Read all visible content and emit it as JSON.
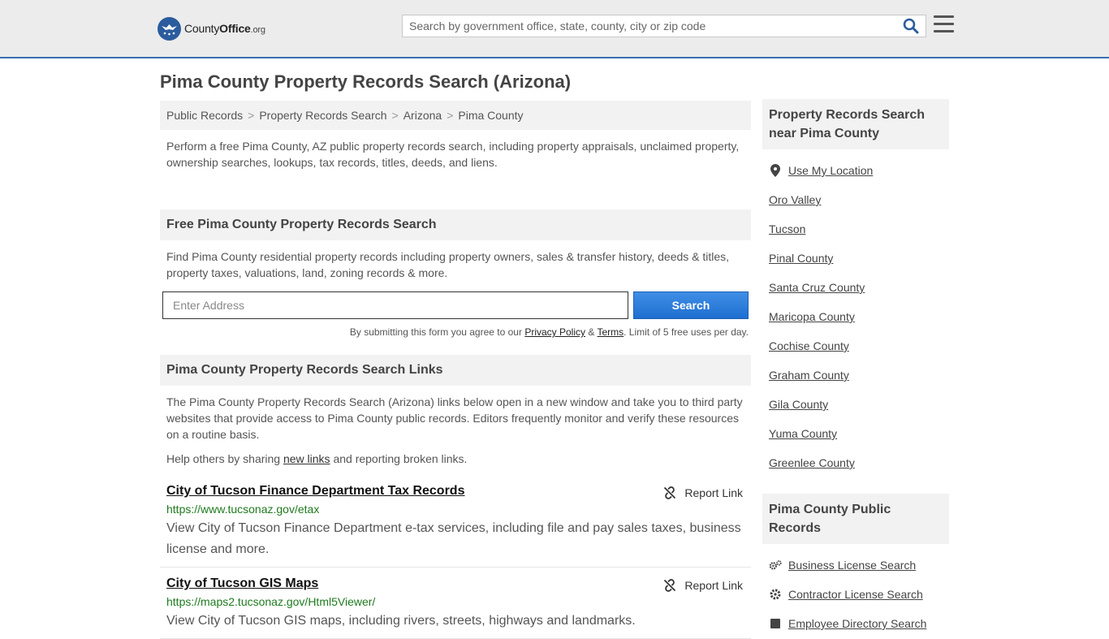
{
  "header": {
    "logo_main": "County",
    "logo_bold": "Office",
    "logo_org": ".org",
    "search_placeholder": "Search by government office, state, county, city or zip code"
  },
  "page_title": "Pima County Property Records Search (Arizona)",
  "breadcrumb": [
    {
      "label": "Public Records"
    },
    {
      "label": "Property Records Search"
    },
    {
      "label": "Arizona"
    },
    {
      "label": "Pima County"
    }
  ],
  "intro": "Perform a free Pima County, AZ public property records search, including property appraisals, unclaimed property, ownership searches, lookups, tax records, titles, deeds, and liens.",
  "free_search": {
    "heading": "Free Pima County Property Records Search",
    "text": "Find Pima County residential property records including property owners, sales & transfer history, deeds & titles, property taxes, valuations, land, zoning records & more.",
    "address_placeholder": "Enter Address",
    "button_label": "Search",
    "terms_prefix": "By submitting this form you agree to our ",
    "privacy_label": "Privacy Policy",
    "terms_amp": " & ",
    "terms_label": "Terms",
    "terms_suffix": ". Limit of 5 free uses per day."
  },
  "links_section": {
    "heading": "Pima County Property Records Search Links",
    "text": "The Pima County Property Records Search (Arizona) links below open in a new window and take you to third party websites that provide access to Pima County public records. Editors frequently monitor and verify these resources on a routine basis.",
    "help_prefix": "Help others by sharing ",
    "help_link": "new links",
    "help_suffix": " and reporting broken links.",
    "report_label": "Report Link",
    "items": [
      {
        "title": "City of Tucson Finance Department Tax Records",
        "url": "https://www.tucsonaz.gov/etax",
        "desc": "View City of Tucson Finance Department e-tax services, including file and pay sales taxes, business license and more."
      },
      {
        "title": "City of Tucson GIS Maps",
        "url": "https://maps2.tucsonaz.gov/Html5Viewer/",
        "desc": "View City of Tucson GIS maps, including rivers, streets, highways and landmarks."
      }
    ]
  },
  "sidebar": {
    "nearby_heading": "Property Records Search near Pima County",
    "use_location": "Use My Location",
    "nearby": [
      "Oro Valley",
      "Tucson",
      "Pinal County",
      "Santa Cruz County",
      "Maricopa County",
      "Cochise County",
      "Graham County",
      "Gila County",
      "Yuma County",
      "Greenlee County"
    ],
    "public_heading": "Pima County Public Records",
    "public_links": [
      "Business License Search",
      "Contractor License Search",
      "Employee Directory Search"
    ]
  },
  "colors": {
    "accent": "#2b5c9e",
    "button": "#1e6fd0",
    "url_green": "#1e7a1e"
  }
}
